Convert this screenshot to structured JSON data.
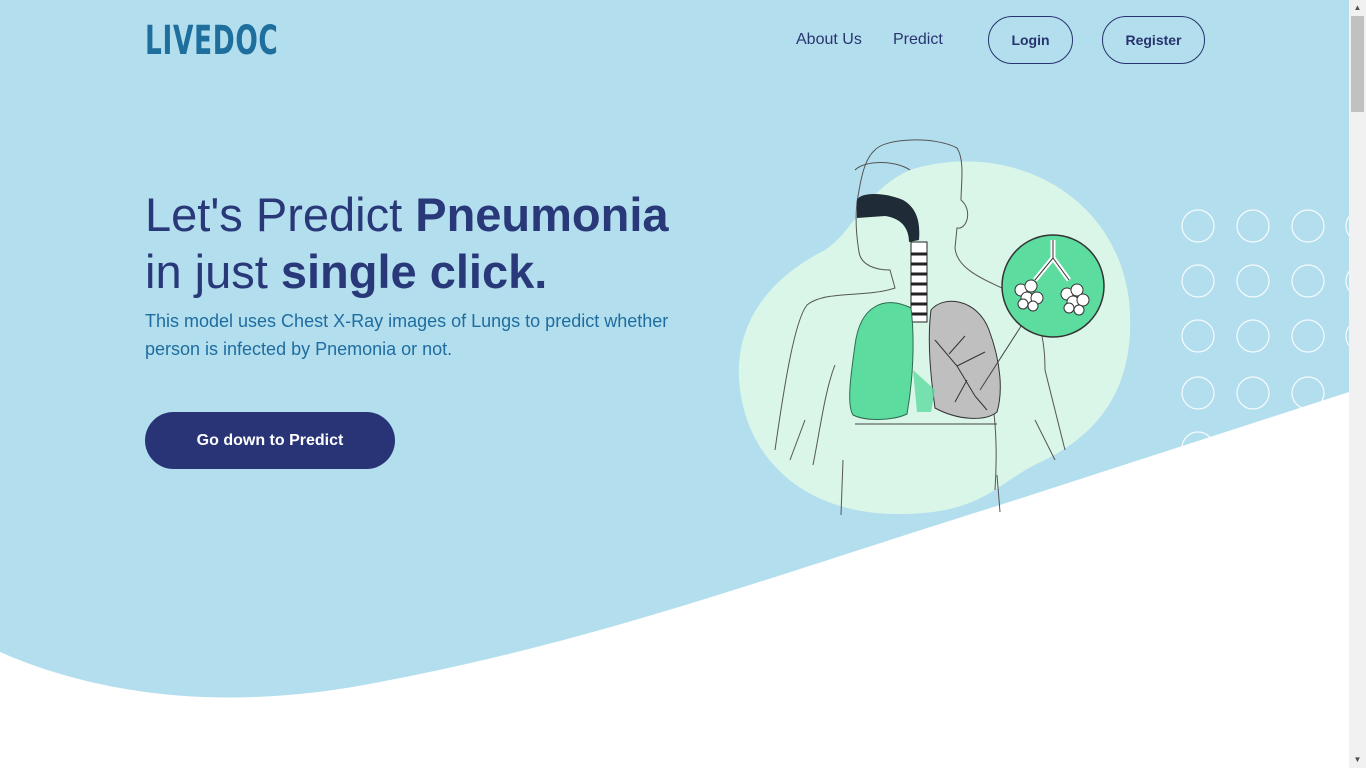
{
  "brand": {
    "logo_text": "LIVEDOC"
  },
  "nav": {
    "about_label": "About Us",
    "predict_label": "Predict",
    "login_label": "Login",
    "register_label": "Register"
  },
  "hero": {
    "title_line1_light": "Let's Predict ",
    "title_line1_bold": "Pneumonia",
    "title_line2_light": "in just ",
    "title_line2_bold": "single click.",
    "description": "This model uses Chest X-Ray images of Lungs to predict whether person is infected by Pnemonia or not.",
    "cta_label": "Go down to Predict"
  },
  "colors": {
    "background_blue": "#b3deed",
    "navy": "#283476",
    "accent_blue": "#1f6da0",
    "lung_green": "#5ddc9f",
    "blob_mint": "#d9f6e8"
  },
  "icons": {
    "illustration": "human-lungs-illustration",
    "decor": "circle-dots-pattern"
  }
}
